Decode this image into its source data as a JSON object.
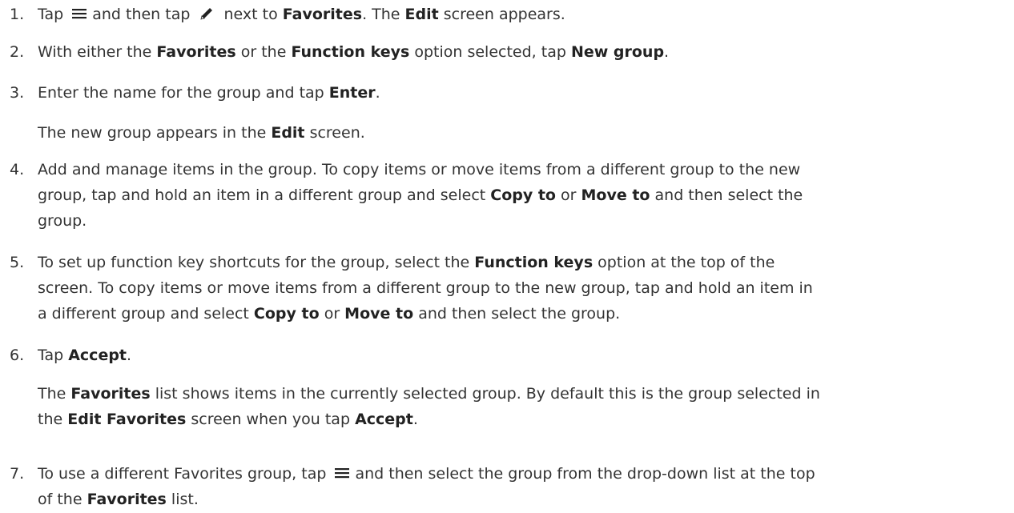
{
  "steps": [
    {
      "number": "1.",
      "t1": "Tap ",
      "icon1": "hamburger-menu-icon",
      "t2": "and then tap ",
      "icon2": "pencil-edit-icon",
      "t3": " next to ",
      "b1": "Favorites",
      "t4": ". The ",
      "b2": "Edit",
      "t5": " screen appears."
    },
    {
      "number": "2.",
      "t1": "With either the ",
      "b1": "Favorites",
      "t2": " or the ",
      "b2": "Function keys",
      "t3": " option selected, tap ",
      "b3": "New group",
      "t4": "."
    },
    {
      "number": "3.",
      "t1": "Enter the name for the group and tap ",
      "b1": "Enter",
      "t2": ".",
      "note_t1": "The new group appears in the ",
      "note_b1": "Edit",
      "note_t2": " screen."
    },
    {
      "number": "4.",
      "line1": "Add and manage items in the group. To copy items or move items from a different group to the new",
      "line2_t1": "group, tap and hold an item in a different group and select ",
      "line2_b1": "Copy to",
      "line2_t2": " or ",
      "line2_b2": "Move to",
      "line2_t3": " and then select the",
      "line3": "group."
    },
    {
      "number": "5.",
      "line1_t1": "To set up function key shortcuts for the group, select the ",
      "line1_b1": "Function keys",
      "line1_t2": " option at the top of the",
      "line2": "screen. To copy items or move items from a different group to the new group, tap and hold an item in",
      "line3_t1": "a different group and select ",
      "line3_b1": "Copy to",
      "line3_t2": " or ",
      "line3_b2": "Move to",
      "line3_t3": " and then select the group."
    },
    {
      "number": "6.",
      "t1": "Tap ",
      "b1": "Accept",
      "t2": ".",
      "note_l1_t1": "The ",
      "note_l1_b1": "Favorites",
      "note_l1_t2": " list shows items in the currently selected group. By default this is the group selected in",
      "note_l2_t1": "the ",
      "note_l2_b1": "Edit Favorites",
      "note_l2_t2": " screen when you tap ",
      "note_l2_b2": "Accept",
      "note_l2_t3": "."
    },
    {
      "number": "7.",
      "line1_t1": "To use a different Favorites group, tap ",
      "icon1": "hamburger-menu-icon",
      "line1_t2": "and then select the group from the drop-down list at the top",
      "line2_t1": "of the ",
      "line2_b1": "Favorites",
      "line2_t2": " list."
    }
  ]
}
